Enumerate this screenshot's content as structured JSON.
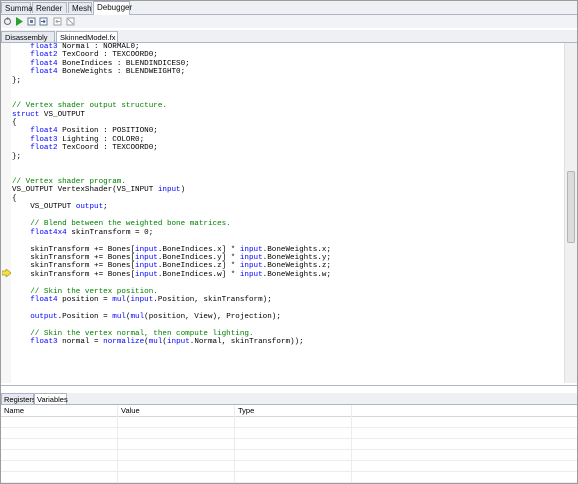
{
  "top_tabs": [
    "Summary",
    "Render",
    "Mesh",
    "Debugger"
  ],
  "toolbar": {
    "buttons": [
      "restart-icon",
      "run-icon",
      "step-over-icon",
      "step-into-icon",
      "step-out-icon",
      "run-to-cursor-icon"
    ]
  },
  "file_tabs": [
    "Disassembly",
    "SkinnedModel.fx"
  ],
  "code_lines": [
    [
      [
        "    ",
        ""
      ],
      [
        "float3",
        "kw"
      ],
      [
        " Normal : NORMAL0;",
        ""
      ]
    ],
    [
      [
        "    ",
        ""
      ],
      [
        "float2",
        "kw"
      ],
      [
        " TexCoord : TEXCOORD0;",
        ""
      ]
    ],
    [
      [
        "    ",
        ""
      ],
      [
        "float4",
        "kw"
      ],
      [
        " BoneIndices : BLENDINDICES0;",
        ""
      ]
    ],
    [
      [
        "    ",
        ""
      ],
      [
        "float4",
        "kw"
      ],
      [
        " BoneWeights : BLENDWEIGHT0;",
        ""
      ]
    ],
    [
      [
        "};",
        ""
      ]
    ],
    [
      [
        "",
        ""
      ]
    ],
    [
      [
        "",
        ""
      ]
    ],
    [
      [
        "// Vertex shader output structure.",
        "cm"
      ]
    ],
    [
      [
        "struct",
        "kw"
      ],
      [
        " VS_OUTPUT",
        ""
      ]
    ],
    [
      [
        "{",
        ""
      ]
    ],
    [
      [
        "    ",
        ""
      ],
      [
        "float4",
        "kw"
      ],
      [
        " Position : POSITION0;",
        ""
      ]
    ],
    [
      [
        "    ",
        ""
      ],
      [
        "float3",
        "kw"
      ],
      [
        " Lighting : COLOR0;",
        ""
      ]
    ],
    [
      [
        "    ",
        ""
      ],
      [
        "float2",
        "kw"
      ],
      [
        " TexCoord : TEXCOORD0;",
        ""
      ]
    ],
    [
      [
        "};",
        ""
      ]
    ],
    [
      [
        "",
        ""
      ]
    ],
    [
      [
        "",
        ""
      ]
    ],
    [
      [
        "// Vertex shader program.",
        "cm"
      ]
    ],
    [
      [
        "VS_OUTPUT VertexShader(VS_INPUT ",
        ""
      ],
      [
        "input",
        "kw"
      ],
      [
        ")",
        ""
      ]
    ],
    [
      [
        "{",
        ""
      ]
    ],
    [
      [
        "    VS_OUTPUT ",
        ""
      ],
      [
        "output",
        "kw"
      ],
      [
        ";",
        ""
      ]
    ],
    [
      [
        "",
        ""
      ]
    ],
    [
      [
        "    // Blend between the weighted bone matrices.",
        "cm"
      ]
    ],
    [
      [
        "    ",
        ""
      ],
      [
        "float4x4",
        "kw"
      ],
      [
        " skinTransform = 0;",
        ""
      ]
    ],
    [
      [
        "",
        ""
      ]
    ],
    [
      [
        "    skinTransform += Bones[",
        ""
      ],
      [
        "input",
        "kw"
      ],
      [
        ".BoneIndices.x] * ",
        ""
      ],
      [
        "input",
        "kw"
      ],
      [
        ".BoneWeights.x;",
        ""
      ]
    ],
    [
      [
        "    skinTransform += Bones[",
        ""
      ],
      [
        "input",
        "kw"
      ],
      [
        ".BoneIndices.y] * ",
        ""
      ],
      [
        "input",
        "kw"
      ],
      [
        ".BoneWeights.y;",
        ""
      ]
    ],
    [
      [
        "    skinTransform += Bones[",
        ""
      ],
      [
        "input",
        "kw"
      ],
      [
        ".BoneIndices.z] * ",
        ""
      ],
      [
        "input",
        "kw"
      ],
      [
        ".BoneWeights.z;",
        ""
      ]
    ],
    [
      [
        "    skinTransform += Bones[",
        ""
      ],
      [
        "input",
        "kw"
      ],
      [
        ".BoneIndices.w] * ",
        ""
      ],
      [
        "input",
        "kw"
      ],
      [
        ".BoneWeights.w;",
        ""
      ]
    ],
    [
      [
        "",
        ""
      ]
    ],
    [
      [
        "    // Skin the vertex position.",
        "cm"
      ]
    ],
    [
      [
        "    ",
        ""
      ],
      [
        "float4",
        "kw"
      ],
      [
        " position = ",
        ""
      ],
      [
        "mul",
        "kw"
      ],
      [
        "(",
        ""
      ],
      [
        "input",
        "kw"
      ],
      [
        ".Position, skinTransform);",
        ""
      ]
    ],
    [
      [
        "",
        ""
      ]
    ],
    [
      [
        "    ",
        ""
      ],
      [
        "output",
        "kw"
      ],
      [
        ".Position = ",
        ""
      ],
      [
        "mul",
        "kw"
      ],
      [
        "(",
        ""
      ],
      [
        "mul",
        "kw"
      ],
      [
        "(position, View), Projection);",
        ""
      ]
    ],
    [
      [
        "",
        ""
      ]
    ],
    [
      [
        "    // Skin the vertex normal, then compute lighting.",
        "cm"
      ]
    ],
    [
      [
        "    ",
        ""
      ],
      [
        "float3",
        "kw"
      ],
      [
        " normal = ",
        ""
      ],
      [
        "normalize",
        "kw"
      ],
      [
        "(",
        ""
      ],
      [
        "mul",
        "kw"
      ],
      [
        "(",
        ""
      ],
      [
        "input",
        "kw"
      ],
      [
        ".Normal, skinTransform));",
        ""
      ]
    ]
  ],
  "bottom_tabs": [
    "Registers",
    "Variables"
  ],
  "variables_table": {
    "columns": [
      "Name",
      "Value",
      "Type"
    ],
    "rows": []
  }
}
